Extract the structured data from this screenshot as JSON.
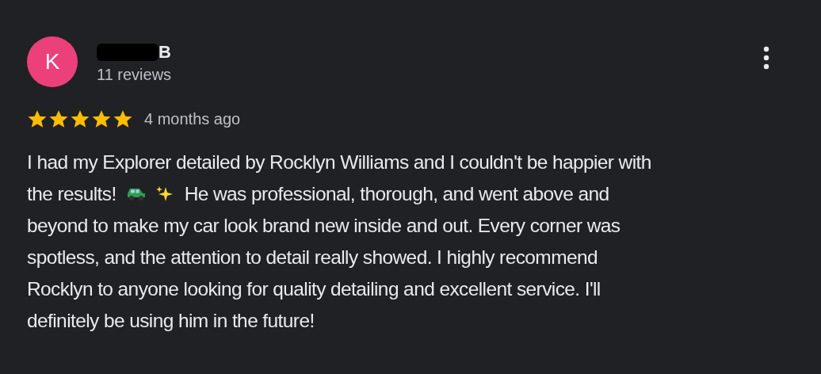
{
  "review": {
    "avatar_initial": "K",
    "name": "B",
    "reviews": "11 reviews",
    "stars": 5,
    "time": "4 months ago",
    "body_lines": [
      [
        {
          "kind": "text",
          "text": "I had my Explorer detailed by Rocklyn Williams and I couldn't be happier with"
        }
      ],
      [
        {
          "kind": "text",
          "text": "the results!"
        },
        {
          "kind": "car"
        },
        {
          "kind": "sparkles"
        },
        {
          "kind": "text",
          "text": "He was professional, thorough, and went above and"
        }
      ],
      [
        {
          "kind": "text",
          "text": "beyond to make my car look brand new inside and out. Every corner was"
        }
      ],
      [
        {
          "kind": "text",
          "text": "spotless, and the attention to detail really showed. I highly recommend"
        }
      ],
      [
        {
          "kind": "text",
          "text": "Rocklyn to anyone looking for quality detailing and excellent service. I'll"
        }
      ],
      [
        {
          "kind": "text",
          "text": "definitely be using him in the future!"
        }
      ]
    ]
  }
}
